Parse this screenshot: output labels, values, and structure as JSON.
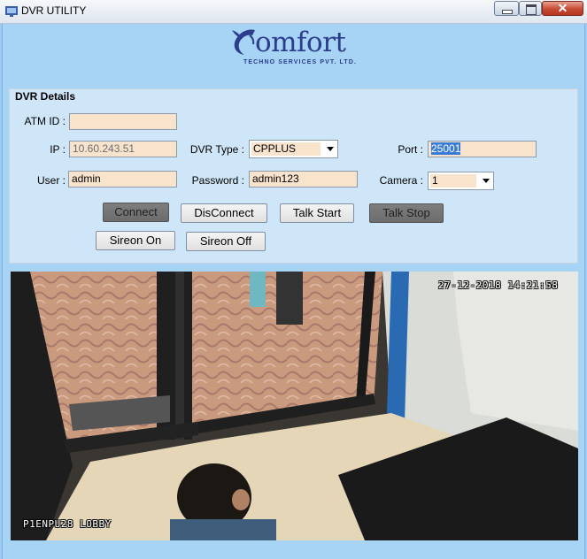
{
  "window": {
    "title": "DVR UTILITY"
  },
  "logo": {
    "word": "omfort",
    "tagline": "TECHNO SERVICES PVT. LTD."
  },
  "dvr_details": {
    "group_title": "DVR Details",
    "atm_id": {
      "label": "ATM ID :",
      "value": ""
    },
    "ip": {
      "label": "IP :",
      "value": "10.60.243.51"
    },
    "dvr_type": {
      "label": "DVR Type :",
      "value": "CPPLUS"
    },
    "port": {
      "label": "Port :",
      "value": "25001"
    },
    "user": {
      "label": "User :",
      "value": "admin"
    },
    "password": {
      "label": "Password :",
      "value": "admin123"
    },
    "camera": {
      "label": "Camera :",
      "value": "1"
    }
  },
  "buttons": {
    "connect": "Connect",
    "disconnect": "DisConnect",
    "talk_start": "Talk Start",
    "talk_stop": "Talk Stop",
    "sireon_on": "Sireon On",
    "sireon_off": "Sireon Off"
  },
  "video": {
    "timestamp": "27-12-2018 14:21:58",
    "camera_name": "P1ENPU28 LOBBY"
  },
  "colors": {
    "background": "#a7d3f5",
    "field_fill": "#f8e3cc",
    "logo": "#2b3d8c",
    "selection": "#3a7bd5"
  }
}
